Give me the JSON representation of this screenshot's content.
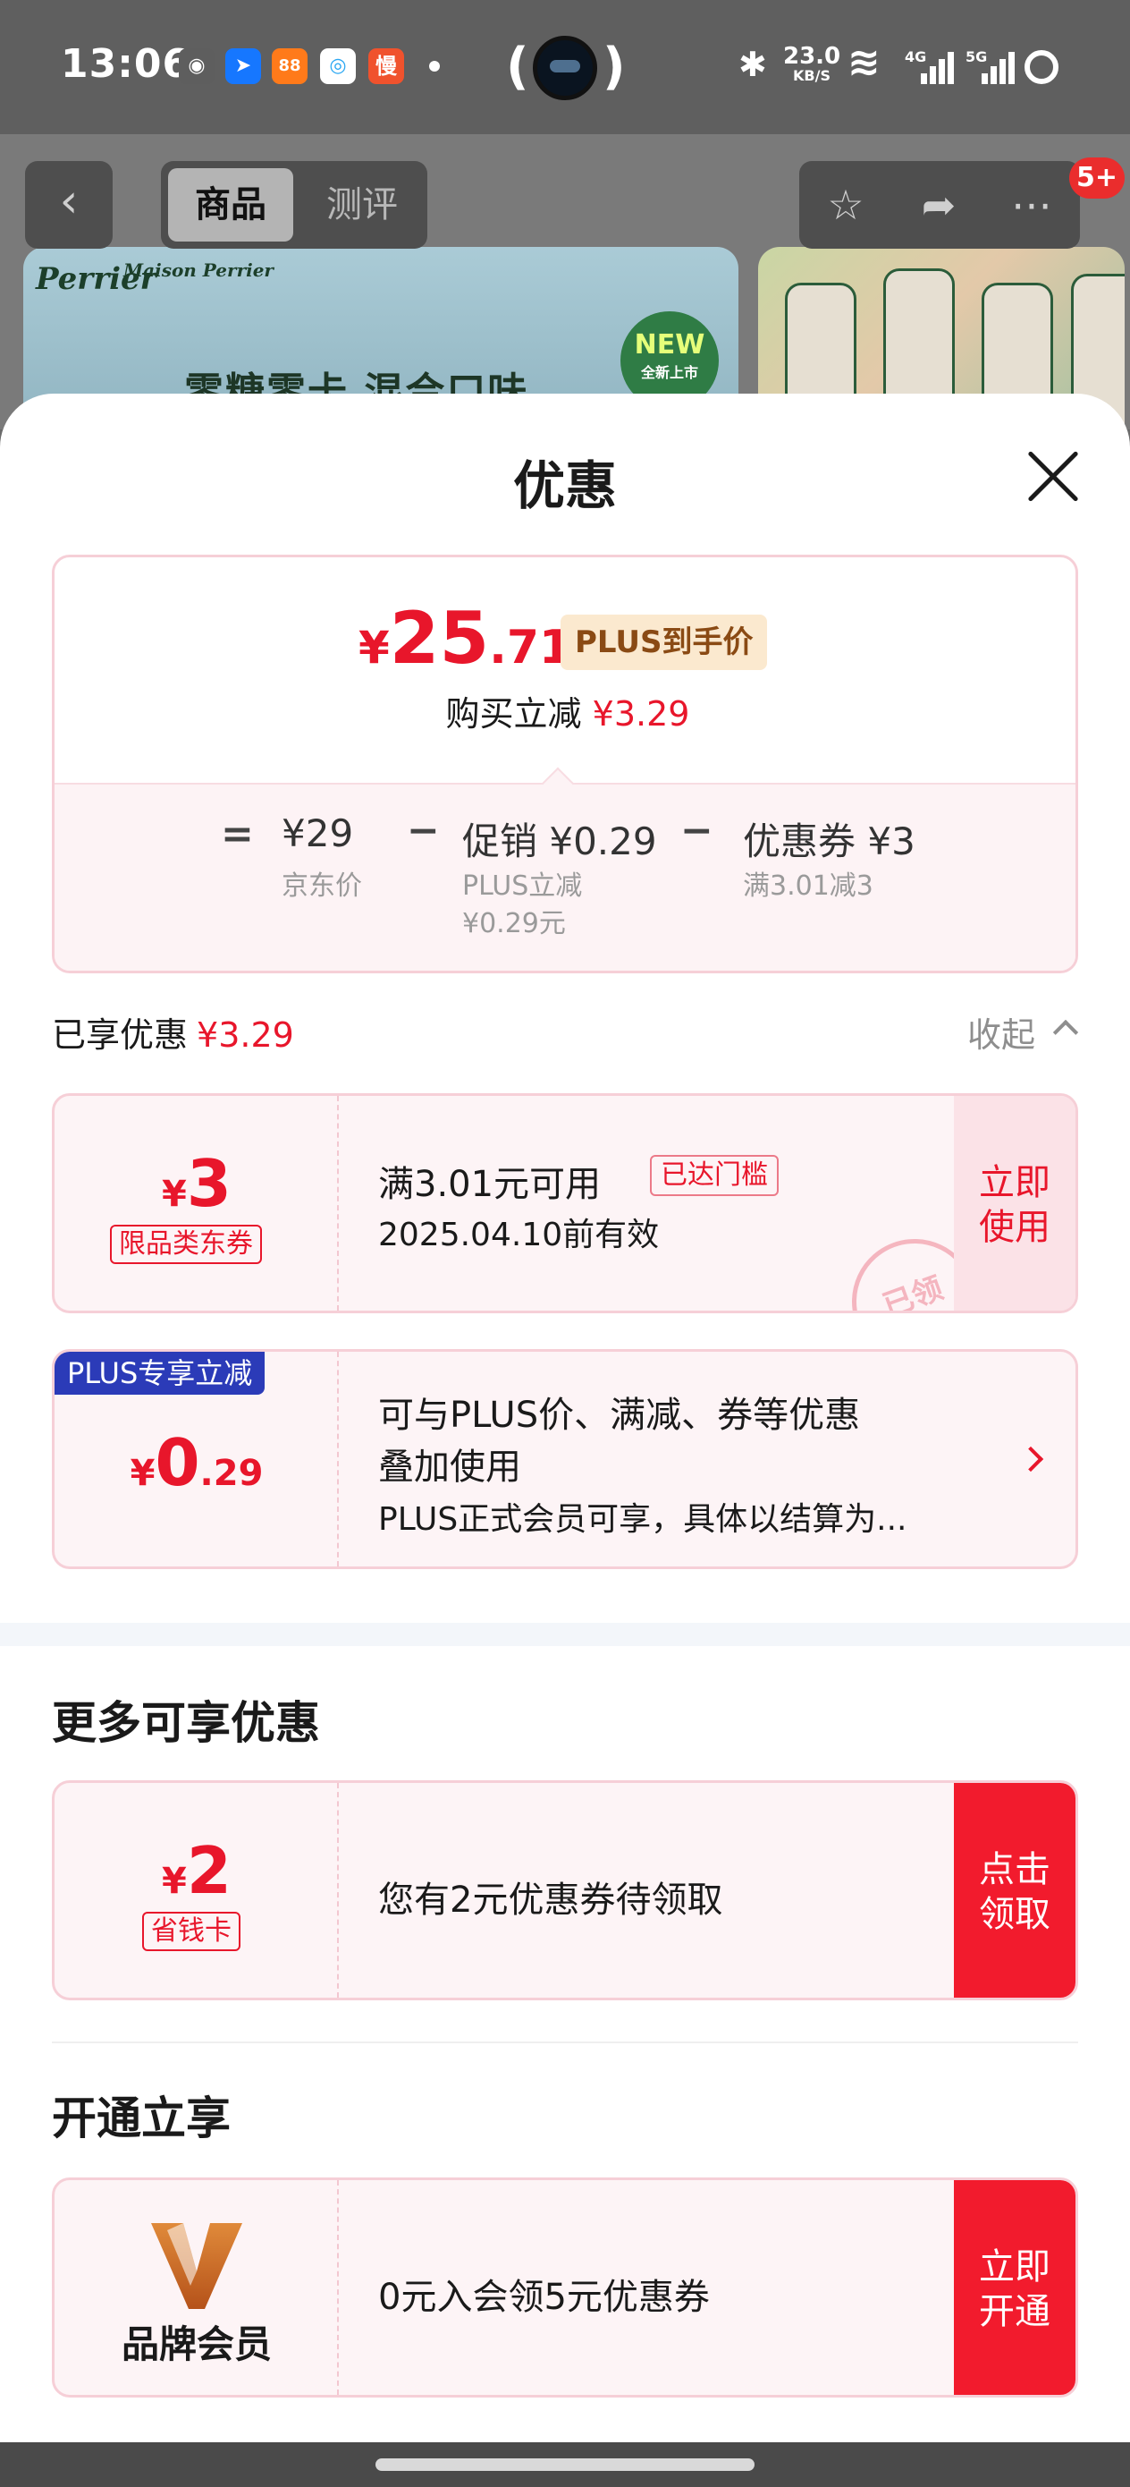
{
  "status_bar": {
    "time": "13:06",
    "apps": [
      {
        "icon": "wechat-icon",
        "glyph": "◉",
        "color": "#5e5e5e"
      },
      {
        "icon": "feishu-icon",
        "glyph": "➤",
        "color": "#1677ff"
      },
      {
        "icon": "app-88-icon",
        "glyph": "88",
        "color": "#ff7a1a"
      },
      {
        "icon": "search-app-icon",
        "glyph": "◎",
        "color": "#ffffff"
      },
      {
        "icon": "manmanbuy-icon",
        "glyph": "慢",
        "color": "#f0522d"
      }
    ],
    "net_speed": "23.0",
    "net_unit": "KB/S",
    "sig1_label": "4G",
    "sig2_label": "5G"
  },
  "product_page": {
    "tab_goods": "商品",
    "tab_review": "测评",
    "cart_badge": "5+",
    "banner_logo": "Perrier",
    "banner_logo_sub": "Maison Perrier",
    "banner_slogan": "零糖零卡 混合口味",
    "banner_new": "NEW",
    "banner_new_sub": "全新上市"
  },
  "sheet": {
    "title": "优惠",
    "summary": {
      "currency": "¥",
      "price_int": "25",
      "price_dec": ".71",
      "plus_tag": "PLUS到手价",
      "buy_label": "购买立减",
      "buy_amount": "¥3.29",
      "eq": "=",
      "jd_price": "¥29",
      "jd_price_label": "京东价",
      "minus1": "−",
      "promo": "促销 ¥0.29",
      "promo_sub1": "PLUS立减",
      "promo_sub2": "¥0.29元",
      "minus2": "−",
      "coupon": "优惠券 ¥3",
      "coupon_sub": "满3.01减3"
    },
    "enjoyed_label": "已享优惠",
    "enjoyed_amount": "¥3.29",
    "collapse_label": "收起",
    "coupon_card": {
      "currency": "¥",
      "value": "3",
      "tag": "限品类东券",
      "line1": "满3.01元可用",
      "ready_tag": "已达门槛",
      "line2": "2025.04.10前有效",
      "use_button": "立即使用",
      "stamp": "已领"
    },
    "plus_card": {
      "corner": "PLUS专享立减",
      "currency": "¥",
      "value_int": "0",
      "value_dec": ".29",
      "line1": "可与PLUS价、满减、券等优惠",
      "line2": "叠加使用",
      "line3": "PLUS正式会员可享，具体以结算为..."
    },
    "more_title": "更多可享优惠",
    "saver_card": {
      "currency": "¥",
      "value": "2",
      "tag": "省钱卡",
      "line1": "您有2元优惠券待领取",
      "cta": "点击领取"
    },
    "open_title": "开通立享",
    "member_card": {
      "brand_name": "品牌会员",
      "line1": "0元入会领5元优惠券",
      "cta": "立即开通"
    }
  },
  "colors": {
    "accent_red": "#e8162b",
    "plus_blue": "#2b3bb8",
    "card_bg": "#fdf4f6",
    "border_pink": "#f6cfd7"
  }
}
